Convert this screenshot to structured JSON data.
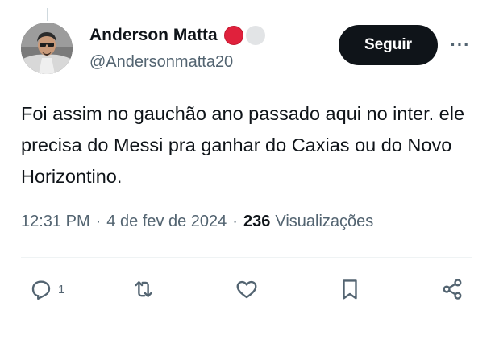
{
  "author": {
    "name": "Anderson Matta",
    "handle": "@Andersonmatta20",
    "badge_colors": [
      "#e0213c",
      "#e2e4e6"
    ]
  },
  "follow_button": {
    "label": "Seguir"
  },
  "more_button": {
    "label": "···"
  },
  "tweet": {
    "text": "Foi assim no gauchão ano passado aqui no inter. ele precisa do Messi pra ganhar do Caxias ou do Novo Horizontino."
  },
  "meta": {
    "time": "12:31 PM",
    "date": "4 de fev de 2024",
    "separator": "·",
    "views_count": "236",
    "views_label": "Visualizações"
  },
  "actions": {
    "reply_count": "1",
    "icons": [
      "reply-icon",
      "retweet-icon",
      "like-icon",
      "bookmark-icon",
      "share-icon"
    ]
  },
  "colors": {
    "text": "#0f1419",
    "secondary": "#536471",
    "button": "#0f1419",
    "divider": "#eff3f4"
  }
}
